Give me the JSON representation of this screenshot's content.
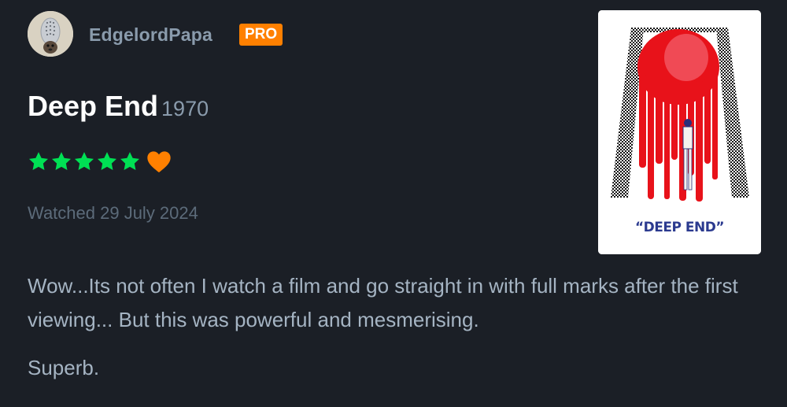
{
  "user": {
    "name": "EdgelordPapa",
    "badge": "PRO"
  },
  "film": {
    "title": "Deep End",
    "year": "1970",
    "poster_title": "“DEEP END”"
  },
  "rating": {
    "stars": 5,
    "max": 5,
    "liked": true,
    "star_icon": "star-icon",
    "like_icon": "heart-icon"
  },
  "watched": "Watched 29 July 2024",
  "review": {
    "paragraphs": [
      "Wow...Its not often I watch a film and go straight in with full marks after the first viewing... But this was powerful and mesmerising.",
      "Superb."
    ]
  },
  "colors": {
    "background": "#1b1f26",
    "star": "#00e054",
    "heart": "#ff8000",
    "badge": "#ff8000"
  }
}
